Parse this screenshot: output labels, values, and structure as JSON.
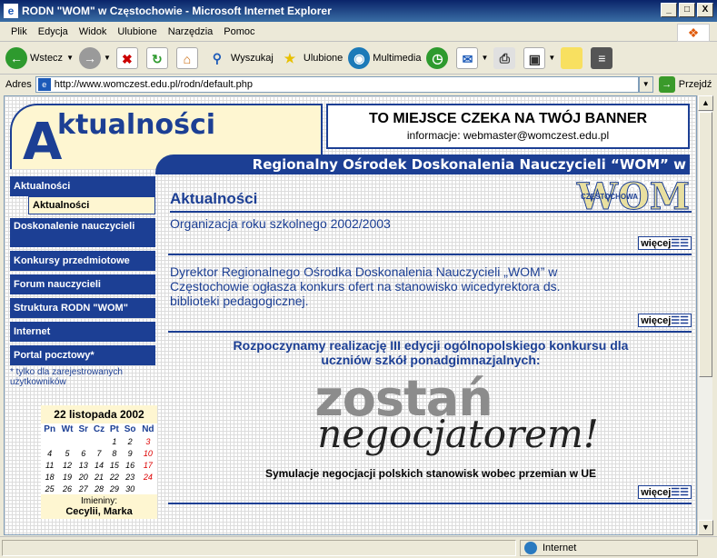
{
  "window": {
    "title": "RODN \"WOM\" w Częstochowie - Microsoft Internet Explorer",
    "min": "_",
    "max": "□",
    "close": "X"
  },
  "menu": [
    "Plik",
    "Edycja",
    "Widok",
    "Ulubione",
    "Narzędzia",
    "Pomoc"
  ],
  "toolbar": {
    "back": "Wstecz",
    "search": "Wyszukaj",
    "favorites": "Ulubione",
    "media": "Multimedia"
  },
  "address": {
    "label": "Adres",
    "url": "http://www.womczest.edu.pl/rodn/default.php",
    "go": "Przejdź"
  },
  "status": {
    "zone": "Internet"
  },
  "page": {
    "header_letter": "A",
    "header_title": "ktualności",
    "banner_title": "TO MIEJSCE CZEKA NA TWÓJ BANNER",
    "banner_info": "informacje: webmaster@womczest.edu.pl",
    "band": "Regionalny Ośrodek Doskonalenia Nauczycieli “WOM” w Częstochowie",
    "nav": [
      {
        "label": "Aktualności"
      },
      {
        "label": "Doskonalenie nauczycieli"
      },
      {
        "label": "Konkursy przedmiotowe"
      },
      {
        "label": "Forum nauczycieli"
      },
      {
        "label": "Struktura RODN \"WOM\""
      },
      {
        "label": "Internet"
      },
      {
        "label": "Portal pocztowy*"
      }
    ],
    "nav_sub": "Aktualności",
    "nav_note": "* tylko dla zarejestrowanych użytkowników",
    "calendar": {
      "date": "22 listopada 2002",
      "days": [
        "Pn",
        "Wt",
        "Sr",
        "Cz",
        "Pt",
        "So",
        "Nd"
      ],
      "weeks": [
        [
          "",
          "",
          "",
          "",
          "1",
          "2",
          "3"
        ],
        [
          "4",
          "5",
          "6",
          "7",
          "8",
          "9",
          "10"
        ],
        [
          "11",
          "12",
          "13",
          "14",
          "15",
          "16",
          "17"
        ],
        [
          "18",
          "19",
          "20",
          "21",
          "22",
          "23",
          "24"
        ],
        [
          "25",
          "26",
          "27",
          "28",
          "29",
          "30",
          ""
        ]
      ],
      "names_label": "Imieniny:",
      "names": "Cecylii, Marka"
    },
    "main_title": "Aktualności",
    "wom_small": "CZĘSTOCHOWA",
    "wom": "WOM",
    "more": "więcej",
    "news": [
      {
        "text": "Organizacja roku szkolnego 2002/2003"
      },
      {
        "text": "Dyrektor Regionalnego Ośrodka Doskonalenia Nauczycieli „WOM” w Częstochowie ogłasza konkurs ofert na stanowisko wicedyrektora ds. biblioteki pedagogicznej."
      }
    ],
    "promo": {
      "text": "Rozpoczynamy realizację III edycji ogólnopolskiego konkursu dla uczniów szkół ponadgimnazjalnych:",
      "logo1": "zostań",
      "logo2": "negocjatorem!",
      "sub": "Symulacje negocjacji polskich stanowisk wobec przemian w UE"
    }
  }
}
